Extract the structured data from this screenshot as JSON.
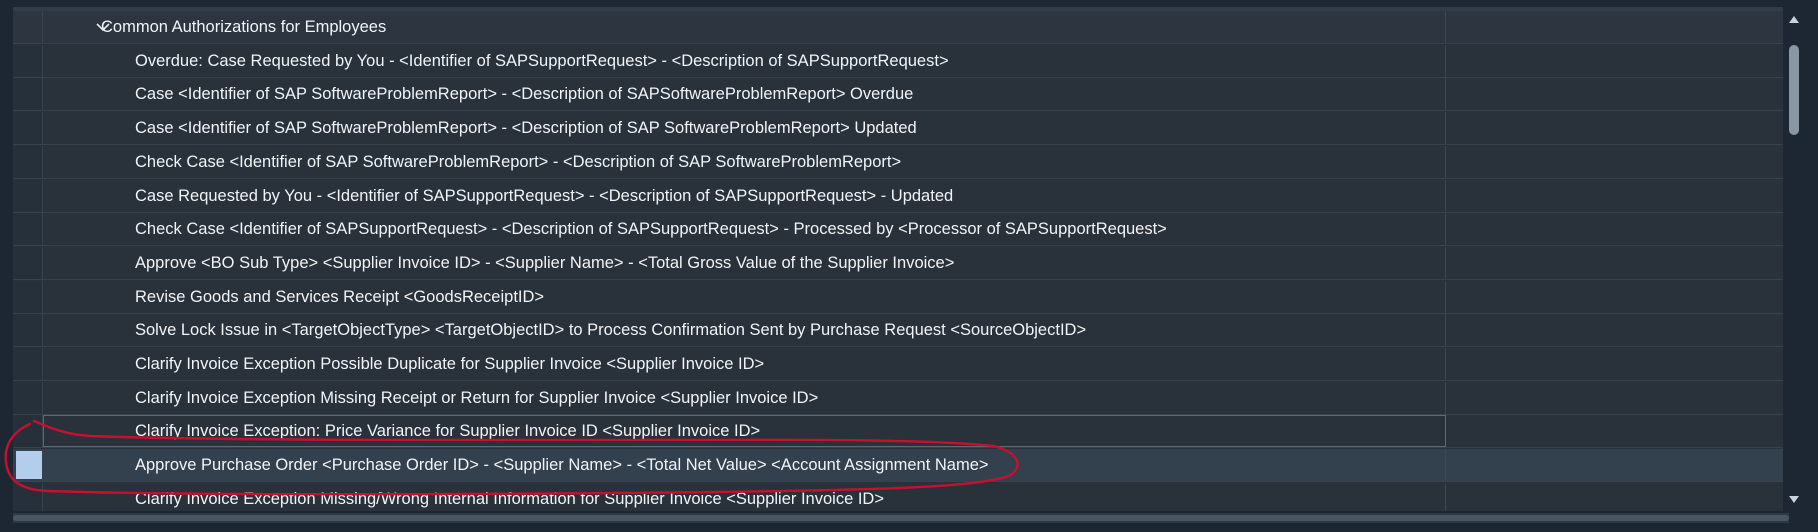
{
  "group": {
    "label": "Common Authorizations for Employees",
    "expanded": true
  },
  "rows": [
    "Overdue: Case Requested by You - <Identifier of SAPSupportRequest> - <Description of SAPSupportRequest>",
    "Case <Identifier of SAP SoftwareProblemReport> - <Description of SAPSoftwareProblemReport> Overdue",
    "Case <Identifier of SAP SoftwareProblemReport> - <Description of SAP SoftwareProblemReport> Updated",
    "Check Case <Identifier of SAP SoftwareProblemReport> - <Description of SAP SoftwareProblemReport>",
    "Case Requested by You - <Identifier of SAPSupportRequest> - <Description of SAPSupportRequest> - Updated",
    "Check Case <Identifier of SAPSupportRequest> - <Description of SAPSupportRequest> - Processed by <Processor of SAPSupportRequest>",
    "Approve <BO Sub Type> <Supplier Invoice ID> - <Supplier Name> - <Total Gross Value of the Supplier Invoice>",
    "Revise Goods and Services Receipt <GoodsReceiptID>",
    "Solve Lock Issue in <TargetObjectType> <TargetObjectID> to Process Confirmation Sent by Purchase Request <SourceObjectID>",
    "Clarify Invoice Exception Possible Duplicate for Supplier Invoice <Supplier Invoice ID>",
    "Clarify Invoice Exception Missing Receipt or Return for Supplier Invoice <Supplier Invoice ID>",
    "Clarify Invoice Exception: Price Variance for Supplier Invoice ID <Supplier Invoice ID>",
    "Approve Purchase Order <Purchase Order ID> - <Supplier Name> - <Total Net Value> <Account Assignment Name>",
    "Clarify Invoice Exception Missing/Wrong Internal Information for Supplier Invoice <Supplier Invoice ID>"
  ],
  "focused_row_index": 11,
  "selected_row_index": 12,
  "colors": {
    "background": "#1d2733",
    "row": "#29313a",
    "selected_row": "#33404e",
    "selection_marker": "#b3cdec",
    "text": "#f2f4f6",
    "annotation": "#c8102e"
  },
  "icons": {
    "group_toggle": "chevron-down-icon",
    "scroll_up": "triangle-up-icon",
    "scroll_down": "triangle-down-icon"
  }
}
